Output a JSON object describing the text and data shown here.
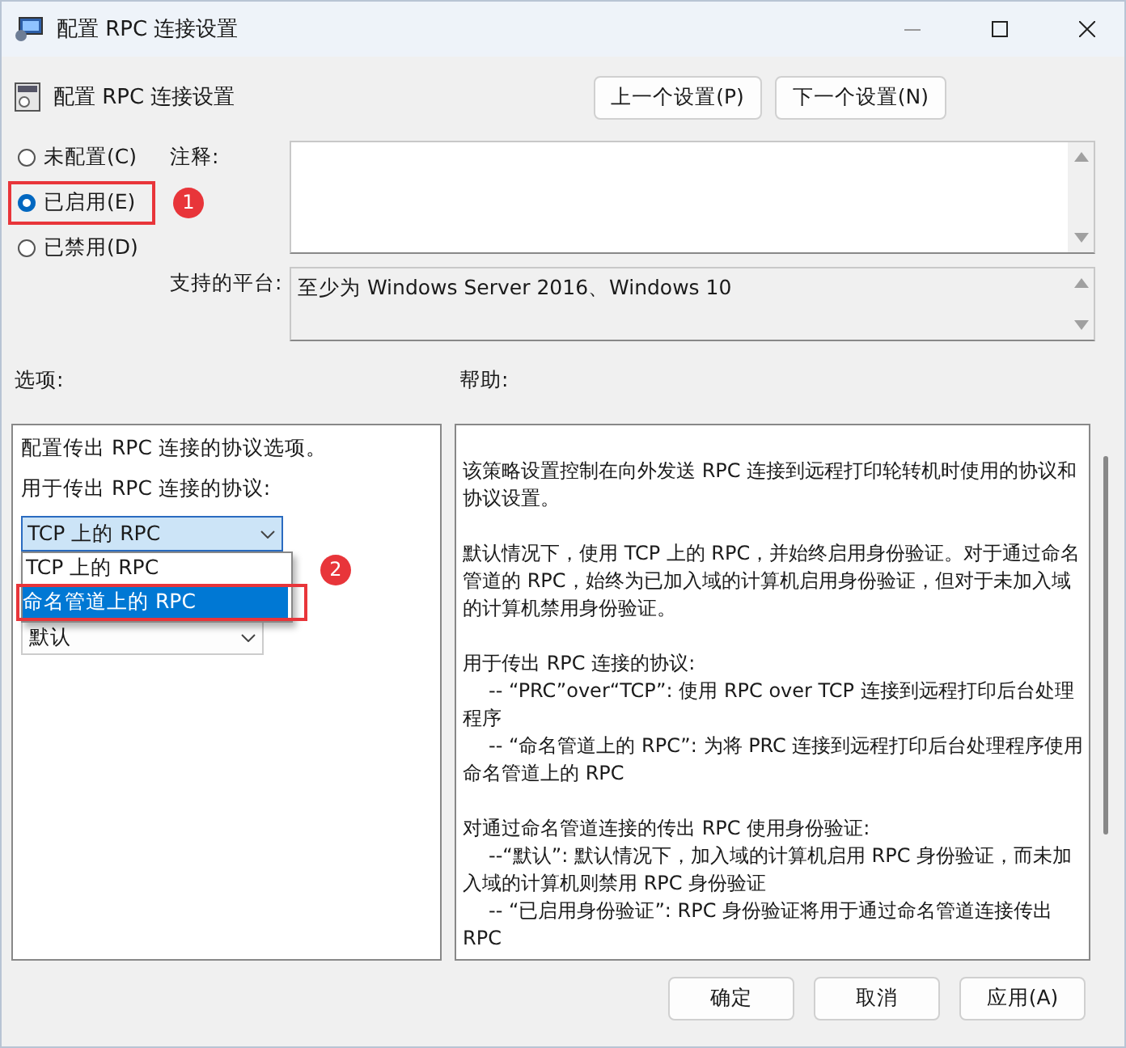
{
  "window": {
    "title": "配置 RPC 连接设置"
  },
  "header": {
    "title": "配置 RPC 连接设置",
    "buttons": [
      "上一个设置(P)",
      "下一个设置(N)"
    ]
  },
  "state_options": [
    {
      "label": "未配置(C)",
      "selected": false
    },
    {
      "label": "已启用(E)",
      "selected": true,
      "annotation": "1"
    },
    {
      "label": "已禁用(D)",
      "selected": false
    }
  ],
  "comment": {
    "label": "注释:"
  },
  "platform": {
    "label": "支持的平台:",
    "value": "至少为 Windows Server 2016、Windows 10"
  },
  "options": {
    "label": "选项:",
    "description": "配置传出 RPC 连接的协议选项。",
    "protocol_label": "用于传出 RPC 连接的协议:",
    "protocol_value": "TCP 上的 RPC",
    "protocol_list": [
      {
        "label": "TCP 上的 RPC",
        "selected": false
      },
      {
        "label": "命名管道上的 RPC",
        "selected": true,
        "annotation": "2"
      }
    ],
    "auth_value": "默认"
  },
  "help": {
    "label": "帮助:",
    "paragraphs": [
      {
        "kind": "text",
        "text": "该策略设置控制在向外发送 RPC 连接到远程打印轮转机时使用的协议和协议设置。"
      },
      {
        "kind": "text",
        "text": "默认情况下，使用 TCP 上的 RPC，并始终启用身份验证。对于通过命名管道的 RPC，始终为已加入域的计算机启用身份验证，但对于未加入域的计算机禁用身份验证。"
      },
      {
        "kind": "heading",
        "text": "用于传出 RPC 连接的协议:"
      },
      {
        "kind": "item",
        "text": "-- “PRC”over“TCP”: 使用 RPC over TCP 连接到远程打印后台处理程序"
      },
      {
        "kind": "item",
        "text": "-- “命名管道上的 RPC”: 为将 PRC 连接到远程打印后台处理程序使用命名管道上的 RPC"
      },
      {
        "kind": "heading",
        "text": "对通过命名管道连接的传出 RPC 使用身份验证:"
      },
      {
        "kind": "item",
        "text": "--“默认”: 默认情况下，加入域的计算机启用 RPC 身份验证，而未加入域的计算机则禁用 RPC 身份验证"
      },
      {
        "kind": "item",
        "text": "-- “已启用身份验证”: RPC 身份验证将用于通过命名管道连接传出 RPC"
      }
    ]
  },
  "footer_buttons": [
    "确定",
    "取消",
    "应用(A)"
  ]
}
